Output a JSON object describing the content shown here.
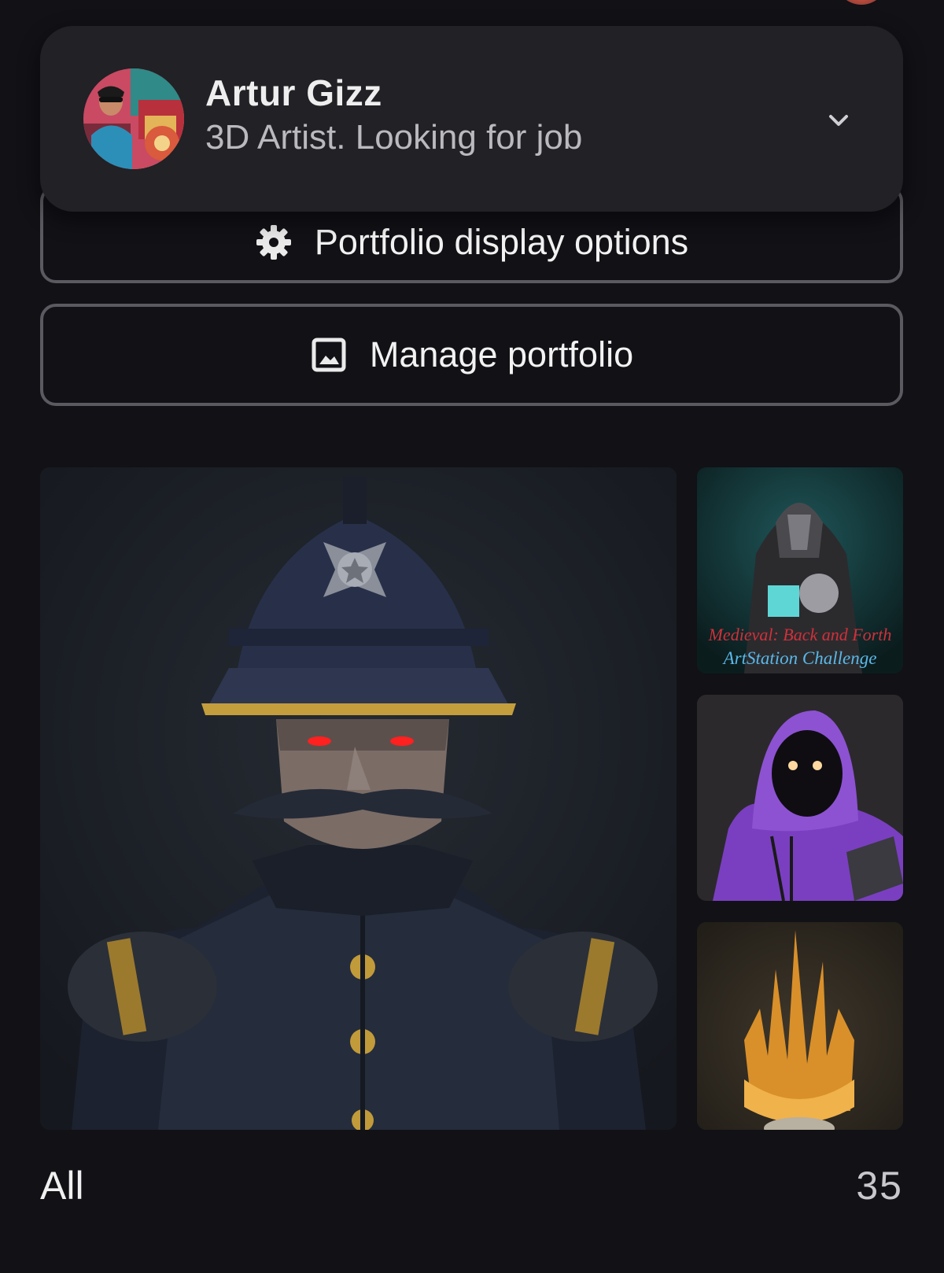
{
  "profile": {
    "name": "Artur Gizz",
    "subtitle": "3D Artist. Looking for job"
  },
  "buttons": {
    "display_options_label": "Portfolio display options",
    "manage_portfolio_label": "Manage portfolio"
  },
  "gallery": {
    "thumbnail_overlay_text": {
      "line1": "Medieval: Back and Forth",
      "line2": "ArtStation Challenge"
    }
  },
  "filter": {
    "label": "All",
    "count": "35"
  },
  "icons": {
    "display_options": "gear-icon",
    "manage_portfolio": "image-icon",
    "expand": "chevron-down-icon"
  },
  "colors": {
    "background": "#111116",
    "card": "#212126",
    "button_border": "#5a5a60",
    "text_primary": "#f2f2f2",
    "text_secondary": "#b9b9be"
  }
}
